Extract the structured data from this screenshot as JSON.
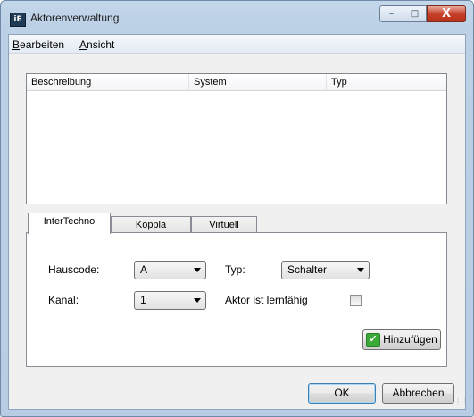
{
  "window": {
    "title": "Aktorenverwaltung",
    "app_icon_text": "iE",
    "controls": {
      "minimize": "–",
      "maximize": "□",
      "close": "X"
    }
  },
  "menubar": {
    "items": [
      {
        "accel": "B",
        "rest": "earbeiten"
      },
      {
        "accel": "A",
        "rest": "nsicht"
      }
    ]
  },
  "listview": {
    "columns": [
      "Beschreibung",
      "System",
      "Typ"
    ]
  },
  "tabs": {
    "items": [
      "InterTechno",
      "Koppla",
      "Virtuell"
    ],
    "active_index": 0
  },
  "form": {
    "hauscode_label": "Hauscode:",
    "hauscode_value": "A",
    "kanal_label": "Kanal:",
    "kanal_value": "1",
    "typ_label": "Typ:",
    "typ_value": "Schalter",
    "lernfaehig_label": "Aktor ist lernfähig",
    "lernfaehig_checked": false,
    "add_button_label": "Hinzufügen",
    "add_button_icon": "check-icon"
  },
  "footer": {
    "ok_label": "OK",
    "cancel_label": "Abbrechen"
  },
  "colors": {
    "frame": "#b8cde3",
    "client_bg": "#f0f0f0",
    "close_red": "#c7412a",
    "add_icon_green": "#3aa935"
  }
}
